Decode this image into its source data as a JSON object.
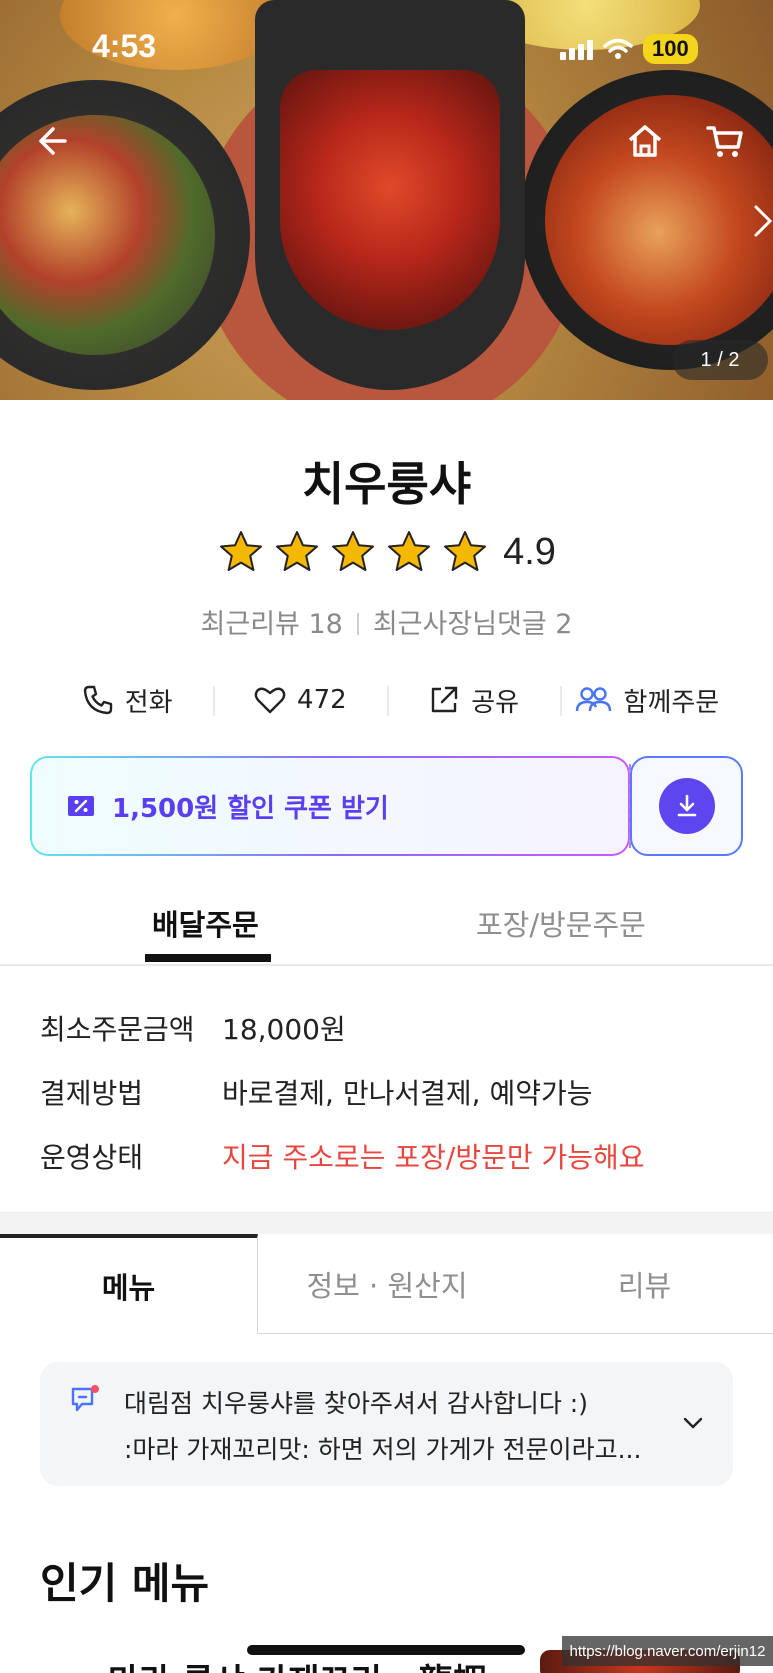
{
  "status_bar": {
    "time": "4:53",
    "battery": "100"
  },
  "hero": {
    "pager": "1 / 2"
  },
  "store": {
    "name": "치우룽샤",
    "rating": "4.9",
    "rating_stars": 5,
    "recent_reviews": "최근리뷰 18",
    "owner_replies": "최근사장님댓글 2"
  },
  "actions": {
    "call": "전화",
    "likes": "472",
    "share": "공유",
    "group_order": "함께주문"
  },
  "coupon": {
    "label": "1,500원 할인 쿠폰 받기"
  },
  "order_tabs": {
    "delivery": "배달주문",
    "pickup": "포장/방문주문"
  },
  "info": [
    {
      "label": "최소주문금액",
      "value": "18,000원"
    },
    {
      "label": "결제방법",
      "value": "바로결제, 만나서결제, 예약가능"
    },
    {
      "label": "운영상태",
      "value": "지금 주소로는 포장/방문만 가능해요"
    }
  ],
  "main_tabs": {
    "menu": "메뉴",
    "info": "정보 · 원산지",
    "review": "리뷰"
  },
  "notice": {
    "line1": "대림점 치우룽샤를 찾아주셔서 감사합니다 :)",
    "line2": ":마라 가재꼬리맛: 하면 저의 가게가 전문이라고..."
  },
  "popular": {
    "title": "인기 메뉴",
    "first_item": "마라 룽샤 가재꼬리 · 龍蝦"
  },
  "watermark": "https://blog.naver.com/erjin12",
  "colors": {
    "accent_purple": "#5c46f0",
    "warn_red": "#e8463f",
    "star": "#f5b800"
  }
}
